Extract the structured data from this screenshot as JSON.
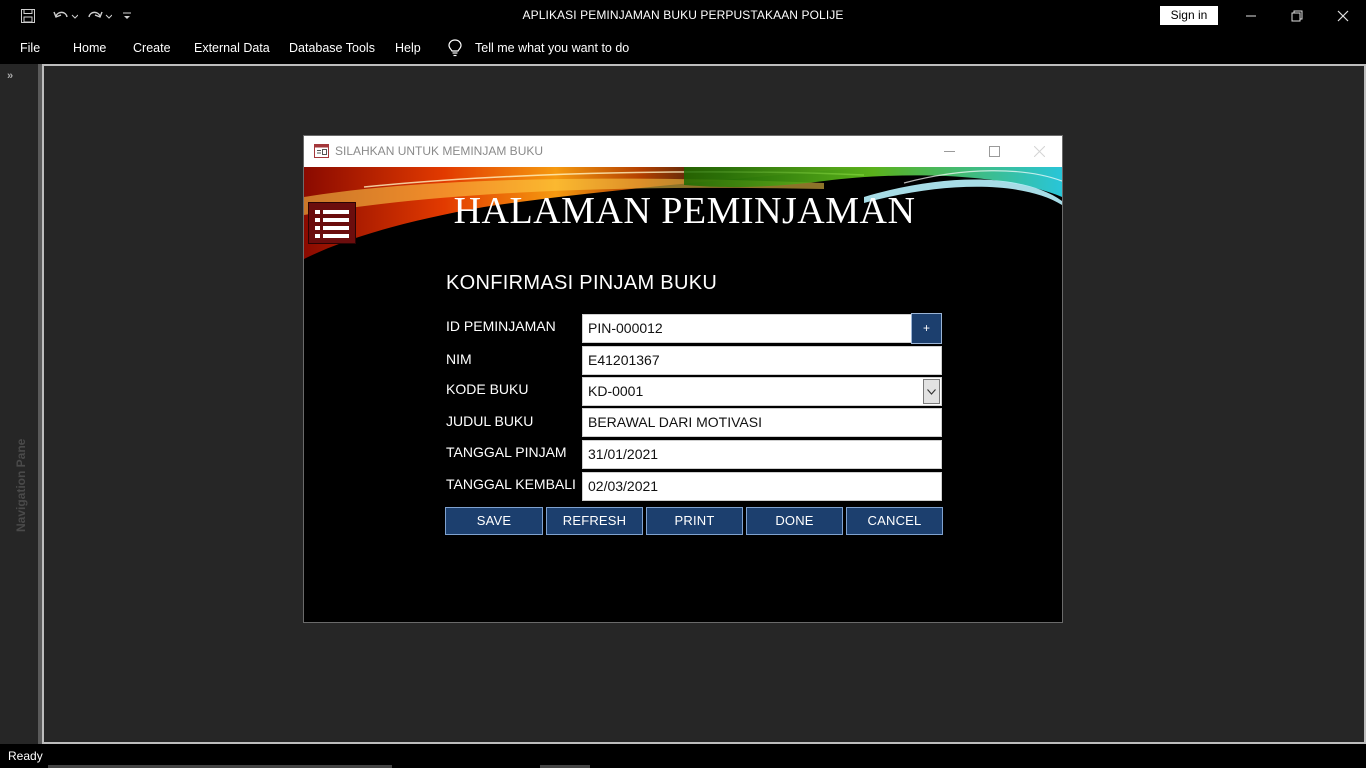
{
  "app": {
    "title": "APLIKASI PEMINJAMAN BUKU PERPUSTAKAAN POLIJE",
    "sign_in": "Sign in"
  },
  "menu": {
    "items": [
      "File",
      "Home",
      "Create",
      "External Data",
      "Database Tools",
      "Help"
    ],
    "tell_me": "Tell me what you want to do"
  },
  "nav_pane": {
    "label": "Navigation Pane"
  },
  "status": {
    "text": "Ready"
  },
  "form_window": {
    "title": "SILAHKAN UNTUK MEMINJAM BUKU",
    "heading": "HALAMAN PEMINJAMAN",
    "section_title": "KONFIRMASI PINJAM BUKU",
    "fields": [
      {
        "label": "ID PEMINJAMAN",
        "value": "PIN-000012"
      },
      {
        "label": "NIM",
        "value": "E41201367"
      },
      {
        "label": "KODE BUKU",
        "value": "KD-0001"
      },
      {
        "label": "JUDUL BUKU",
        "value": "BERAWAL DARI MOTIVASI"
      },
      {
        "label": "TANGGAL PINJAM",
        "value": "31/01/2021"
      },
      {
        "label": "TANGGAL KEMBALI",
        "value": "02/03/2021"
      }
    ],
    "plus_label": "+",
    "buttons": [
      "SAVE",
      "REFRESH",
      "PRINT",
      "DONE",
      "CANCEL"
    ]
  },
  "colors": {
    "button_blue": "#1c3f6e",
    "menu_icon_red": "#6b0d0d",
    "chrome_black": "#000000",
    "workspace_gray": "#262626"
  }
}
